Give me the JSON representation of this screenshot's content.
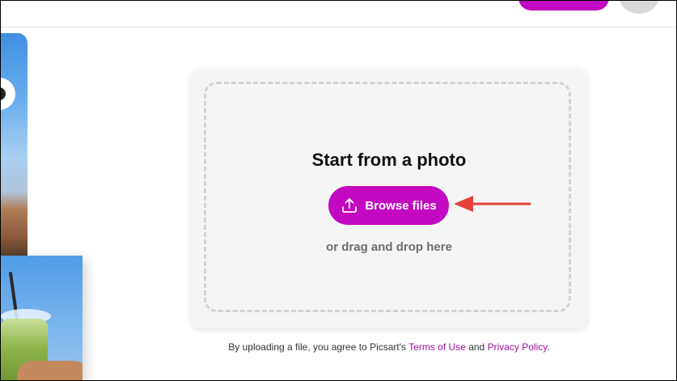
{
  "colors": {
    "accent": "#c209c1",
    "link": "#a30fa3",
    "annotation_arrow": "#e8413b"
  },
  "upload_card": {
    "title": "Start from a photo",
    "browse_button_label": "Browse files",
    "browse_button_icon": "upload-icon",
    "drag_drop_text": "or drag and drop here"
  },
  "legal": {
    "prefix": "By uploading a file, you agree to Picsart's",
    "terms_link": "Terms of Use",
    "and": "and",
    "privacy_link": "Privacy Policy",
    "suffix": "."
  }
}
